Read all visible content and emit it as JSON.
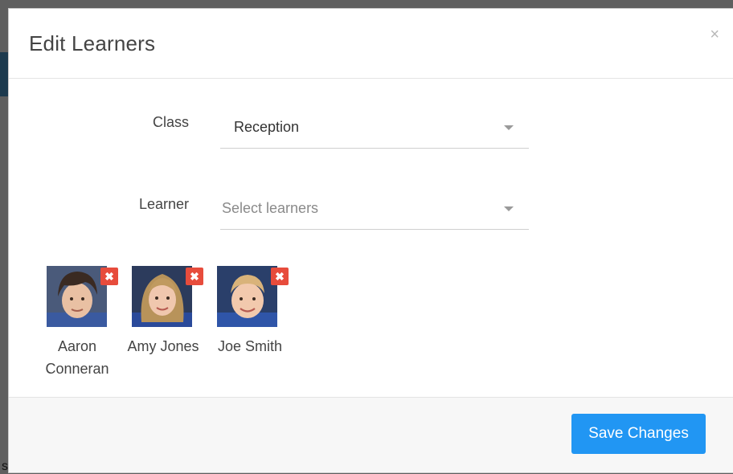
{
  "background": {
    "top_text": "",
    "bottom_text": "s"
  },
  "modal": {
    "title": "Edit Learners",
    "close_label": "×"
  },
  "form": {
    "class": {
      "label": "Class",
      "value": "Reception"
    },
    "learner": {
      "label": "Learner",
      "placeholder": "Select learners"
    }
  },
  "learners": [
    {
      "name": "Aaron Conneran",
      "name_line1": "Aaron",
      "name_line2": "Conneran",
      "remove_label": "✖"
    },
    {
      "name": "Amy Jones",
      "name_line1": "Amy Jones",
      "name_line2": "",
      "remove_label": "✖"
    },
    {
      "name": "Joe Smith",
      "name_line1": "Joe Smith",
      "name_line2": "",
      "remove_label": "✖"
    }
  ],
  "footer": {
    "save_label": "Save Changes"
  },
  "colors": {
    "primary": "#2196f3",
    "remove": "#e74c3c"
  }
}
